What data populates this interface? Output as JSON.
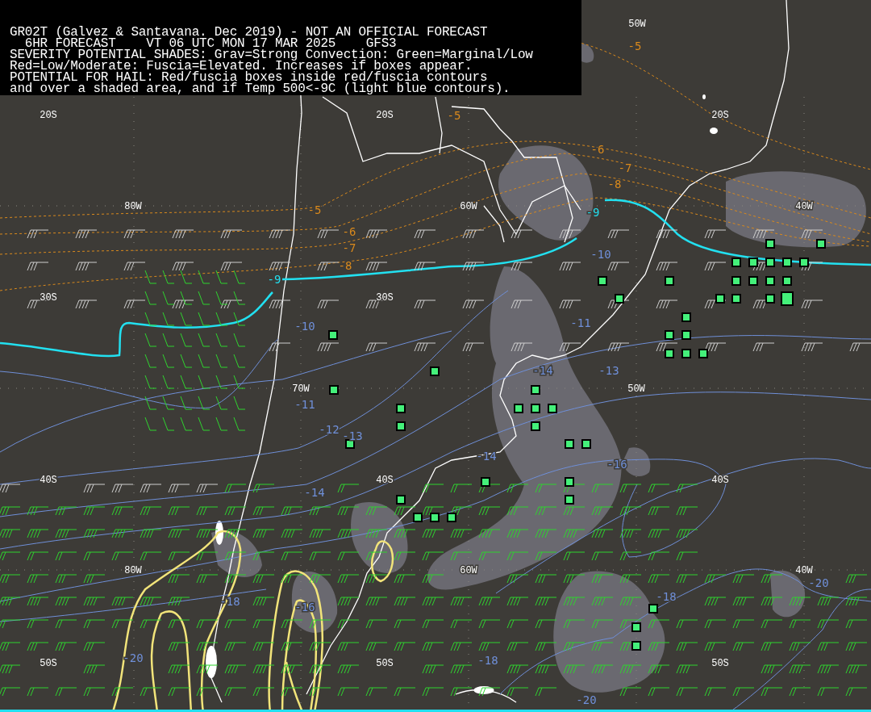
{
  "header": {
    "lines": [
      "GR02T (Galvez & Santavana. Dec 2019) - NOT AN OFFICIAL FORECAST",
      "  6HR FORECAST    VT 06 UTC MON 17 MAR 2025    GFS3",
      "SEVERITY POTENTIAL SHADES: Grav=Strong Convection: Green=Marginal/Low",
      "Red=Low/Moderate: Fuscia=Elevated. Increases if boxes appear.",
      "POTENTIAL FOR HAIL: Red/fuscia boxes inside red/fuscia contours",
      "and over a shaded area, and if Temp 500<-9C (light blue contours)."
    ]
  },
  "grid_labels": [
    "20S",
    "20S",
    "50W",
    "20S",
    "80W",
    "60W",
    "40W",
    "30S",
    "30S",
    "70W",
    "50W",
    "40S",
    "40S",
    "40S",
    "80W",
    "60W",
    "40W",
    "50S",
    "50S",
    "50S"
  ],
  "contour_labels": [
    {
      "text": "-5",
      "color": "#d9891c"
    },
    {
      "text": "-5",
      "color": "#d9891c"
    },
    {
      "text": "-6",
      "color": "#d9891c"
    },
    {
      "text": "-7",
      "color": "#d9891c"
    },
    {
      "text": "-8",
      "color": "#d9891c"
    },
    {
      "text": "-5",
      "color": "#d9891c"
    },
    {
      "text": "-6",
      "color": "#d9891c"
    },
    {
      "text": "-7",
      "color": "#d9891c"
    },
    {
      "text": "-8",
      "color": "#d9891c"
    },
    {
      "text": "-9",
      "color": "#22e0f0"
    },
    {
      "text": "-9",
      "color": "#22e0f0"
    },
    {
      "text": "-10",
      "color": "#6f8fd8"
    },
    {
      "text": "-10",
      "color": "#6f8fd8"
    },
    {
      "text": "-11",
      "color": "#6f8fd8"
    },
    {
      "text": "-11",
      "color": "#6f8fd8"
    },
    {
      "text": "-12",
      "color": "#6f8fd8"
    },
    {
      "text": "-13",
      "color": "#6f8fd8"
    },
    {
      "text": "-14",
      "color": "#6f8fd8"
    },
    {
      "text": "-13",
      "color": "#6f8fd8"
    },
    {
      "text": "-14",
      "color": "#6f8fd8"
    },
    {
      "text": "-14",
      "color": "#6f8fd8"
    },
    {
      "text": "-16",
      "color": "#6f8fd8"
    },
    {
      "text": "-16",
      "color": "#6f8fd8"
    },
    {
      "text": "-18",
      "color": "#6f8fd8"
    },
    {
      "text": "-18",
      "color": "#6f8fd8"
    },
    {
      "text": "-18",
      "color": "#6f8fd8"
    },
    {
      "text": "-20",
      "color": "#6f8fd8"
    },
    {
      "text": "-20",
      "color": "#6f8fd8"
    },
    {
      "text": "-20",
      "color": "#6f8fd8"
    }
  ]
}
